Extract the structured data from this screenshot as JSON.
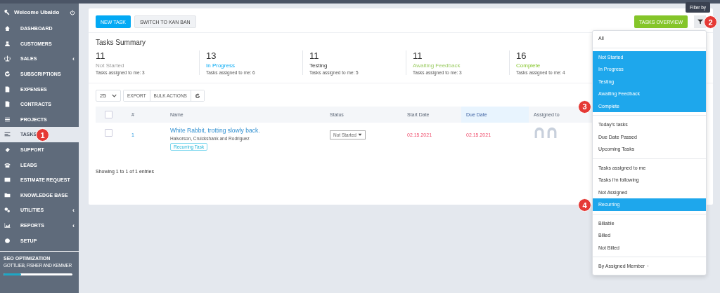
{
  "sidebar": {
    "welcome": "Welcome Ubaldo",
    "items": [
      {
        "label": "DASHBOARD",
        "selected": false
      },
      {
        "label": "CUSTOMERS",
        "selected": false
      },
      {
        "label": "SALES",
        "selected": false,
        "caret": "‹"
      },
      {
        "label": "SUBSCRIPTIONS",
        "selected": false
      },
      {
        "label": "EXPENSES",
        "selected": false
      },
      {
        "label": "CONTRACTS",
        "selected": false
      },
      {
        "label": "PROJECTS",
        "selected": false
      },
      {
        "label": "TASKS",
        "selected": true,
        "callout": "1"
      },
      {
        "label": "SUPPORT",
        "selected": false
      },
      {
        "label": "LEADS",
        "selected": false
      },
      {
        "label": "ESTIMATE REQUEST",
        "selected": false
      },
      {
        "label": "KNOWLEDGE BASE",
        "selected": false
      },
      {
        "label": "UTILITIES",
        "selected": false,
        "caret": "‹"
      },
      {
        "label": "REPORTS",
        "selected": false,
        "caret": "‹"
      },
      {
        "label": "SETUP",
        "selected": false
      }
    ],
    "project": {
      "name": "SEO OPTIMIZATION",
      "client": "GOTTLIEB, FISHER AND KEMMER",
      "level": 0.25
    }
  },
  "toolbar": {
    "new_task": "NEW TASK",
    "switch": "SWITCH TO KAN BAN",
    "overview": "TASKS OVERVIEW",
    "filter_callout": "2",
    "tooltip": "Filter by"
  },
  "summary": {
    "title": "Tasks Summary",
    "items": [
      {
        "count": "11",
        "label": "Not Started",
        "kind": "not_started",
        "assigned": "Tasks assigned to me: 3"
      },
      {
        "count": "13",
        "label": "In Progress",
        "kind": "in_progress",
        "assigned": "Tasks assigned to me: 6"
      },
      {
        "count": "11",
        "label": "Testing",
        "kind": "testing",
        "assigned": "Tasks assigned to me: 5"
      },
      {
        "count": "11",
        "label": "Awaiting Feedback",
        "kind": "awaiting",
        "assigned": "Tasks assigned to me: 3"
      },
      {
        "count": "16",
        "label": "Complete",
        "kind": "complete",
        "assigned": "Tasks assigned to me: 4"
      }
    ]
  },
  "controls": {
    "page_size": "25",
    "export": "EXPORT",
    "bulk": "BULK ACTIONS"
  },
  "table": {
    "select_all": {
      "checked": false
    },
    "columns": [
      "#",
      "Name",
      "Status",
      "Start Date",
      "Due Date",
      "Assigned to"
    ],
    "rows": [
      {
        "checked": false,
        "number": "1",
        "name": "White Rabbit, trotting slowly back.",
        "client": "Halvorson, Cruickshank and Rodriguez",
        "tag": "Recurring Task",
        "status": "Not Started",
        "start": "02.15.2021",
        "due": "02.15.2021"
      }
    ],
    "footer": "Showing 1 to 1 of 1 entries"
  },
  "filter_menu": {
    "groups": [
      [
        {
          "label": "All",
          "selected": false
        }
      ],
      [
        {
          "label": "Not Started",
          "selected": true
        },
        {
          "label": "In Progress",
          "selected": true
        },
        {
          "label": "Testing",
          "selected": true
        },
        {
          "label": "Awaiting Feedback",
          "selected": true
        },
        {
          "label": "Complete",
          "selected": true,
          "callout": "3"
        }
      ],
      [
        {
          "label": "Today's tasks",
          "selected": false
        },
        {
          "label": "Due Date Passed",
          "selected": false
        },
        {
          "label": "Upcoming Tasks",
          "selected": false
        }
      ],
      [
        {
          "label": "Tasks assigned to me",
          "selected": false
        },
        {
          "label": "Tasks i'm following",
          "selected": false
        },
        {
          "label": "Not Assigned",
          "selected": false
        },
        {
          "label": "Recurring",
          "selected": true,
          "callout": "4"
        }
      ],
      [
        {
          "label": "Billable",
          "selected": false
        },
        {
          "label": "Billed",
          "selected": false
        },
        {
          "label": "Not Billed",
          "selected": false
        }
      ],
      [
        {
          "label": "By Assigned Member",
          "selected": false,
          "submenu": "›"
        }
      ]
    ]
  }
}
